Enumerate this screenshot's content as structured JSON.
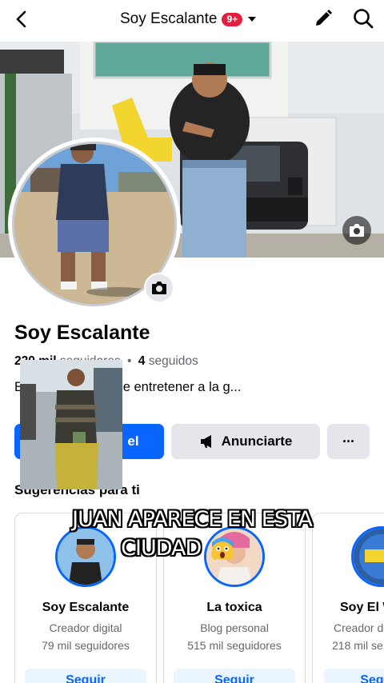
{
  "topbar": {
    "title": "Soy Escalante",
    "badge": "9+"
  },
  "profile": {
    "name": "Soy Escalante",
    "followers_count": "220 mil",
    "followers_label": "seguidores",
    "separator": "•",
    "following_count": "4",
    "following_label": "seguidos",
    "bio": "E... ina con fines de entretener a la g..."
  },
  "actions": {
    "primary_label": "el",
    "ads_label": "Anunciarte",
    "more_label": "···"
  },
  "suggestions": {
    "title": "Sugerencias para ti",
    "cards": [
      {
        "name": "Soy Escalante",
        "category": "Creador digital",
        "followers": "79 mil seguidores",
        "button": "Seguir"
      },
      {
        "name": "La toxica",
        "category": "Blog personal",
        "followers": "515 mil seguidores",
        "button": "Seguir"
      },
      {
        "name": "Soy El W",
        "category": "Creador d",
        "followers": "218 mil se",
        "button": "Segui"
      }
    ]
  },
  "overlay": {
    "line1": "JUAN APARECE EN ESTA",
    "line2": "CIUDAD"
  },
  "colors": {
    "accent": "#0866ff",
    "badge": "#e41e3f",
    "secondary_button": "#e4e6eb",
    "muted_text": "#65676b"
  },
  "icons": [
    "back-arrow-icon",
    "caret-down-icon",
    "edit-pencil-icon",
    "search-icon",
    "camera-icon",
    "megaphone-icon",
    "more-dots-icon",
    "shocked-face-icon"
  ]
}
